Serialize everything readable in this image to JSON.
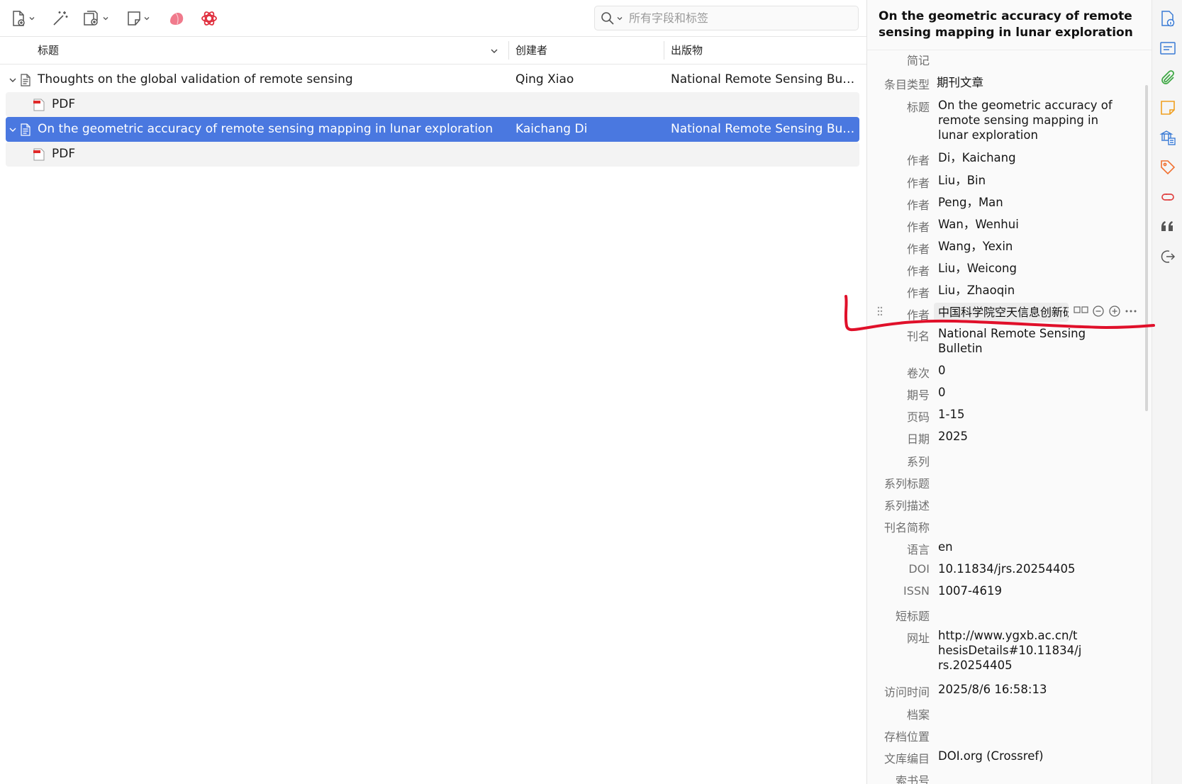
{
  "toolbar": {
    "search_placeholder": "所有字段和标签"
  },
  "columns": {
    "title": "标题",
    "creator": "创建者",
    "publication": "出版物"
  },
  "items": [
    {
      "title": "Thoughts on the global validation of remote sensing",
      "creator": "Qing Xiao",
      "publication": "National Remote Sensing Bulle...",
      "attachment": "PDF",
      "selected": false
    },
    {
      "title": "On the geometric accuracy of remote sensing mapping in lunar exploration",
      "creator": "Kaichang Di",
      "publication": "National Remote Sensing Bulle...",
      "attachment": "PDF",
      "selected": true
    }
  ],
  "item_pane": {
    "header_title": "On the geometric accuracy of remote sensing mapping in lunar exploration",
    "section_label": "简记",
    "fields": {
      "item_type": {
        "label": "条目类型",
        "value": "期刊文章"
      },
      "title": {
        "label": "标题",
        "value": "On the geometric accuracy of remote sensing mapping in lunar exploration"
      },
      "authors_label": "作者",
      "authors": [
        "Di，Kaichang",
        "Liu，Bin",
        "Peng，Man",
        "Wan，Wenhui",
        "Wang，Yexin",
        "Liu，Weicong",
        "Liu，Zhaoqin"
      ],
      "author_editing": "中国科学院空天信息创新研究院",
      "publication": {
        "label": "刊名",
        "value": "National Remote Sensing Bulletin"
      },
      "volume": {
        "label": "卷次",
        "value": "0"
      },
      "issue": {
        "label": "期号",
        "value": "0"
      },
      "pages": {
        "label": "页码",
        "value": "1-15"
      },
      "date": {
        "label": "日期",
        "value": "2025"
      },
      "series": {
        "label": "系列",
        "value": ""
      },
      "series_title": {
        "label": "系列标题",
        "value": ""
      },
      "series_text": {
        "label": "系列描述",
        "value": ""
      },
      "journal_abbr": {
        "label": "刊名简称",
        "value": ""
      },
      "language": {
        "label": "语言",
        "value": "en"
      },
      "doi": {
        "label": "DOI",
        "value": "10.11834/jrs.20254405"
      },
      "issn": {
        "label": "ISSN",
        "value": "1007-4619"
      },
      "short_title": {
        "label": "短标题",
        "value": ""
      },
      "url": {
        "label": "网址",
        "value": "http://www.ygxb.ac.cn/thesisDetails#10.11834/jrs.20254405"
      },
      "accessed": {
        "label": "访问时间",
        "value": "2025/8/6 16:58:13"
      },
      "archive": {
        "label": "档案",
        "value": ""
      },
      "archive_location": {
        "label": "存档位置",
        "value": ""
      },
      "library_catalog": {
        "label": "文库编目",
        "value": "DOI.org (Crossref)"
      },
      "call_number": {
        "label": "索书号",
        "value": ""
      }
    }
  },
  "colors": {
    "selection": "#4a78e0",
    "annotation": "#e0102a",
    "nav_blue": "#3a7bd5",
    "nav_green": "#3fa845",
    "nav_orange": "#f0a020"
  },
  "icons": {
    "toolbar": [
      "new-item-icon",
      "magic-wand-icon",
      "add-attachment-icon",
      "new-note-icon",
      "pink-blob-icon",
      "openai-icon"
    ],
    "sidenav": [
      "info-icon",
      "abstract-icon",
      "attachments-icon",
      "notes-icon",
      "libraries-collections-icon",
      "tags-icon",
      "related-icon",
      "citation-icon",
      "locate-icon"
    ]
  }
}
